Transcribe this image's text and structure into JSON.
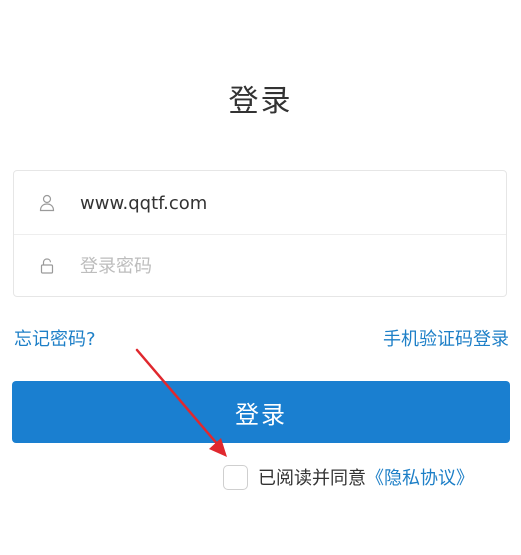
{
  "page": {
    "title": "登录"
  },
  "form": {
    "username": {
      "value": "www.qqtf.com",
      "icon": "user-icon"
    },
    "password": {
      "value": "",
      "placeholder": "登录密码",
      "icon": "lock-icon"
    }
  },
  "links": {
    "forgot_password": "忘记密码?",
    "sms_login": "手机验证码登录"
  },
  "login_button": {
    "label": "登录"
  },
  "agreement": {
    "checked": false,
    "text": "已阅读并同意",
    "privacy_link": "《隐私协议》"
  },
  "colors": {
    "primary": "#1a7fd0",
    "link": "#1d7fc7",
    "annotation_arrow": "#e0282e"
  }
}
